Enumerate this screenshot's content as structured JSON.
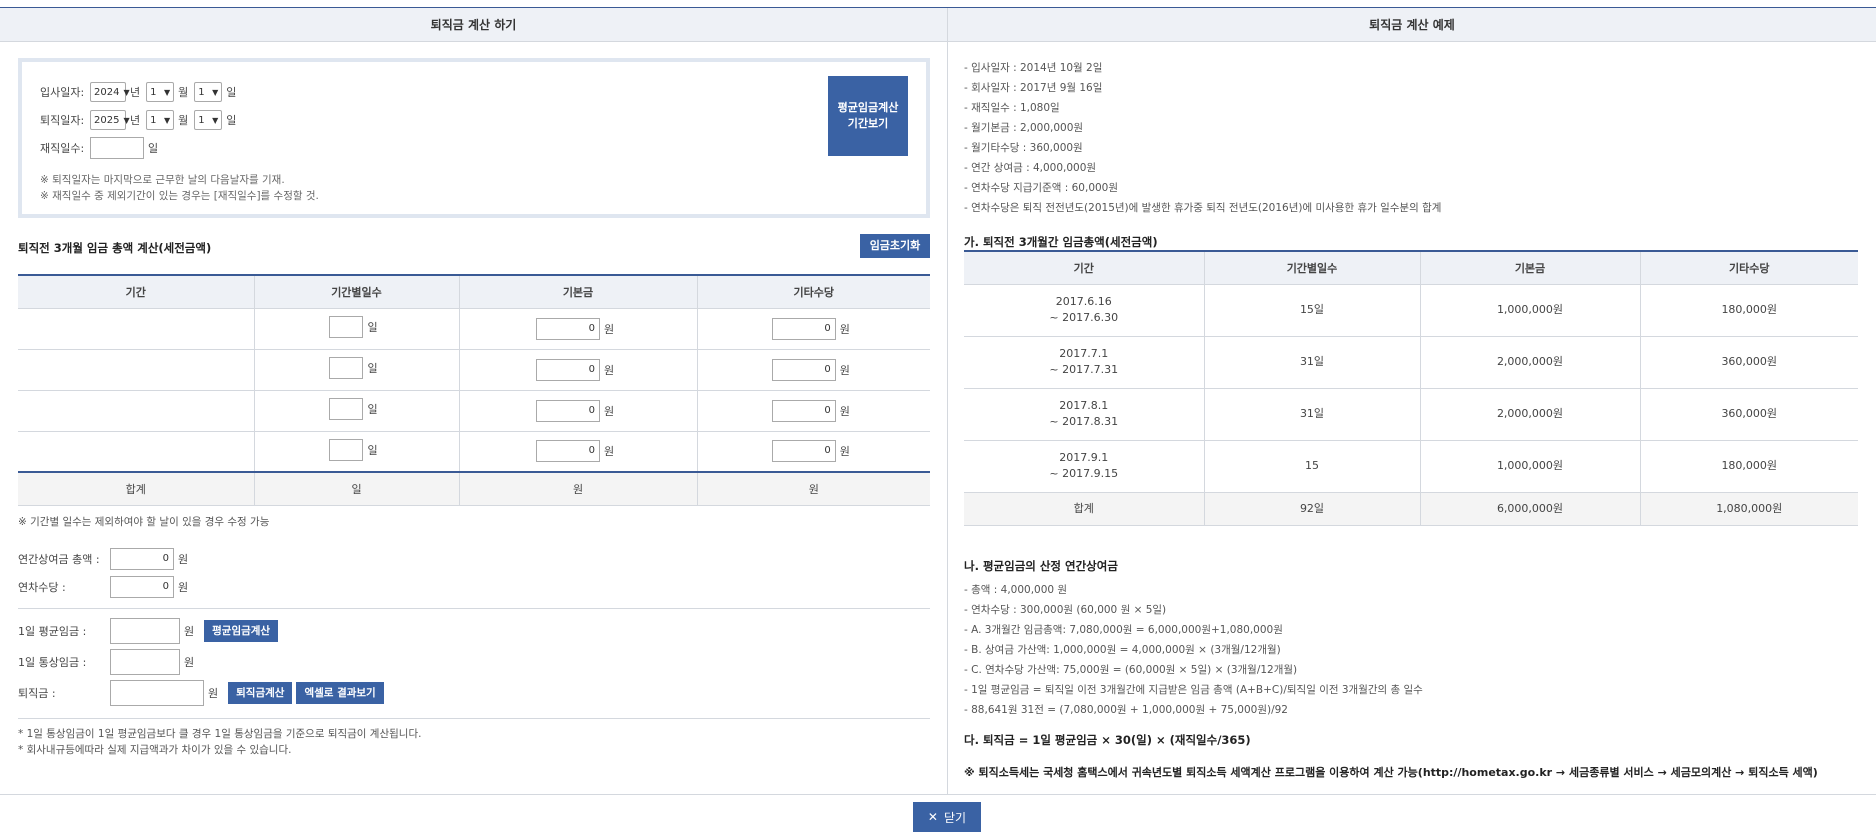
{
  "left": {
    "header": "퇴직금 계산 하기",
    "dates": {
      "join_label": "입사일자:",
      "join_year": "2024",
      "join_month": "1",
      "join_day": "1",
      "leave_label": "퇴직일자:",
      "leave_year": "2025",
      "leave_month": "1",
      "leave_day": "1",
      "year_unit": "년",
      "month_unit": "월",
      "day_unit": "일",
      "tenure_label": "재직일수:",
      "tenure_value": "",
      "tenure_unit": "일",
      "note1": "※ 퇴직일자는 마지막으로 근무한 날의 다음날자를 기재.",
      "note2": "※ 재직일수 중 제외기간이 있는 경우는 [재직일수]를 수정할 것.",
      "avg_period_button_line1": "평균임금계산",
      "avg_period_button_line2": "기간보기"
    },
    "wage_section_title": "퇴직전 3개월 임금 총액 계산(세전금액)",
    "reset_button": "임금초기화",
    "table": {
      "headers": [
        "기간",
        "기간별일수",
        "기본금",
        "기타수당"
      ],
      "rows": [
        {
          "period": "",
          "days": "",
          "base": "0",
          "other": "0"
        },
        {
          "period": "",
          "days": "",
          "base": "0",
          "other": "0"
        },
        {
          "period": "",
          "days": "",
          "base": "0",
          "other": "0"
        },
        {
          "period": "",
          "days": "",
          "base": "0",
          "other": "0"
        }
      ],
      "day_unit": "일",
      "won_unit": "원",
      "sum_label": "합계",
      "sum_days": "일",
      "sum_base": "원",
      "sum_other": "원"
    },
    "table_note": "※ 기간별 일수는 제외하여야 할 날이 있을 경우 수정 가능",
    "bonus_label": "연간상여금 총액 :",
    "bonus_value": "0",
    "leave_pay_label": "연차수당 :",
    "leave_pay_value": "0",
    "won": "원",
    "avg_wage_label": "1일 평균임금 :",
    "avg_wage_value": "",
    "avg_wage_button": "평균임금계산",
    "ordinary_wage_label": "1일 통상임금 :",
    "ordinary_wage_value": "",
    "severance_label": "퇴직금 :",
    "severance_value": "",
    "severance_button": "퇴직금계산",
    "excel_button": "엑셀로 결과보기",
    "footnote1": "* 1일 통상임금이 1일 평균임금보다 클 경우 1일 통상임금을 기준으로 퇴직금이 계산됩니다.",
    "footnote2": "* 회사내규등에따라 실제 지급액과가 차이가 있을 수 있습니다."
  },
  "right": {
    "header": "퇴직금 계산 예제",
    "info": [
      "- 입사일자 : 2014년 10월 2일",
      "- 회사일자 : 2017년 9월 16일",
      "- 재직일수 : 1,080일",
      "- 월기본금 : 2,000,000원",
      "- 월기타수당 : 360,000원",
      "- 연간 상여금 : 4,000,000원",
      "- 연차수당 지급기준액 : 60,000원",
      "- 연차수당은 퇴직 전전년도(2015년)에 발생한 휴가중 퇴직 전년도(2016년)에 미사용한 휴가 일수분의 합계"
    ],
    "section_a_title": "가. 퇴직전 3개월간 임금총액(세전금액)",
    "table": {
      "headers": [
        "기간",
        "기간별일수",
        "기본금",
        "기타수당"
      ],
      "rows": [
        {
          "period1": "2017.6.16",
          "period2": "~ 2017.6.30",
          "days": "15일",
          "base": "1,000,000원",
          "other": "180,000원"
        },
        {
          "period1": "2017.7.1",
          "period2": "~ 2017.7.31",
          "days": "31일",
          "base": "2,000,000원",
          "other": "360,000원"
        },
        {
          "period1": "2017.8.1",
          "period2": "~ 2017.8.31",
          "days": "31일",
          "base": "2,000,000원",
          "other": "360,000원"
        },
        {
          "period1": "2017.9.1",
          "period2": "~ 2017.9.15",
          "days": "15",
          "base": "1,000,000원",
          "other": "180,000원"
        }
      ],
      "sum_label": "합계",
      "sum_days": "92일",
      "sum_base": "6,000,000원",
      "sum_other": "1,080,000원"
    },
    "section_b_title": "나. 평균임금의 산정 연간상여금",
    "calc": [
      "- 총액 : 4,000,000 원",
      "- 연차수당 : 300,000원 (60,000 원 × 5일)",
      "- A. 3개월간 임금총액: 7,080,000원 = 6,000,000원+1,080,000원",
      "- B. 상여금 가산액: 1,000,000원 = 4,000,000원 × (3개월/12개월)",
      "- C. 연차수당 가산액: 75,000원 = (60,000원 × 5일) × (3개월/12개월)",
      "- 1일 평균임금 = 퇴직일 이전 3개월간에 지급받은 임금 총액 (A+B+C)/퇴직일 이전 3개월간의 총 일수",
      "- 88,641원 31전 = (7,080,000원 + 1,000,000원 + 75,000원)/92"
    ],
    "section_c_title": "다. 퇴직금 = 1일 평균임금 × 30(일) × (재직일수/365)",
    "tax_note": "※ 퇴직소득세는 국세청 홈택스에서 귀속년도별 퇴직소득 세액계산 프로그램을 이용하여 계산 가능(http://hometax.go.kr → 세금종류별 서비스 → 세금모의계산 → 퇴직소득 세액)"
  },
  "close_button": "닫기",
  "colors": {
    "accent": "#3a62a4",
    "header_bg": "#eef1f6",
    "rule": "#3a5a95"
  }
}
